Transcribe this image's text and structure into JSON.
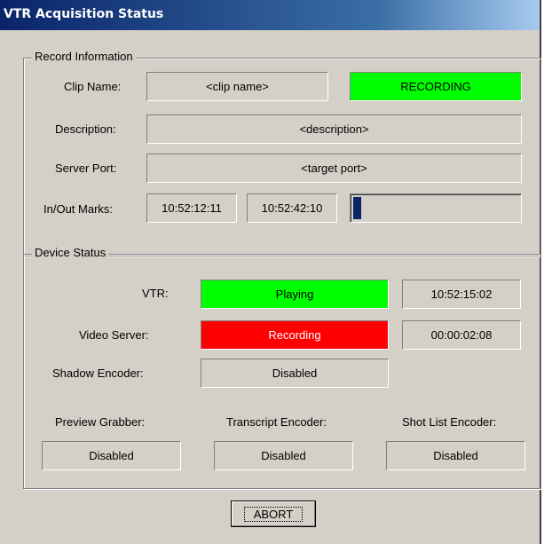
{
  "window": {
    "title": "VTR Acquisition Status"
  },
  "record_information": {
    "group_label": "Record Information",
    "clip_name_label": "Clip Name:",
    "clip_name_value": "<clip name>",
    "recording_status": "RECORDING",
    "description_label": "Description:",
    "description_value": "<description>",
    "server_port_label": "Server Port:",
    "server_port_value": "<target port>",
    "marks_label": "In/Out Marks:",
    "in_mark": "10:52:12:11",
    "out_mark": "10:52:42:10",
    "progress_fraction": 0.05
  },
  "device_status": {
    "group_label": "Device Status",
    "vtr_label": "VTR:",
    "vtr_status": "Playing",
    "vtr_timecode": "10:52:15:02",
    "video_server_label": "Video Server:",
    "video_server_status": "Recording",
    "video_server_timecode": "00:00:02:08",
    "shadow_encoder_label": "Shadow Encoder:",
    "shadow_encoder_status": "Disabled",
    "preview_grabber_label": "Preview Grabber:",
    "preview_grabber_status": "Disabled",
    "transcript_encoder_label": "Transcript Encoder:",
    "transcript_encoder_status": "Disabled",
    "shot_list_encoder_label": "Shot List Encoder:",
    "shot_list_encoder_status": "Disabled"
  },
  "actions": {
    "abort_label": "ABORT"
  },
  "colors": {
    "active_green": "#00ff00",
    "alert_red": "#ff0000",
    "progress_blue": "#0a246a"
  }
}
